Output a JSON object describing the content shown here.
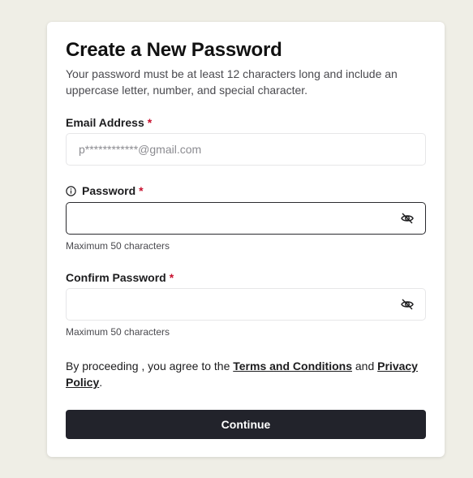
{
  "form": {
    "title": "Create a New Password",
    "subtitle": "Your password must be at least 12 characters long and include an uppercase letter, number, and special character.",
    "email": {
      "label": "Email Address",
      "required_mark": "*",
      "placeholder": "p************@gmail.com",
      "value": ""
    },
    "password": {
      "label": "Password",
      "required_mark": "*",
      "value": "",
      "hint": "Maximum 50 characters",
      "info_icon": "info-circle-icon",
      "toggle_icon": "eye-off-icon"
    },
    "confirm_password": {
      "label": "Confirm Password",
      "required_mark": "*",
      "value": "",
      "hint": "Maximum 50 characters",
      "toggle_icon": "eye-off-icon"
    },
    "terms": {
      "prefix": "By proceeding , you agree to the ",
      "terms_link": "Terms and Conditions",
      "middle": " and ",
      "privacy_link": "Privacy Policy",
      "suffix": "."
    },
    "continue_label": "Continue"
  },
  "colors": {
    "page_background": "#efeee6",
    "card_background": "#ffffff",
    "required": "#c8102e",
    "button_background": "#22232b",
    "button_text": "#ffffff"
  }
}
